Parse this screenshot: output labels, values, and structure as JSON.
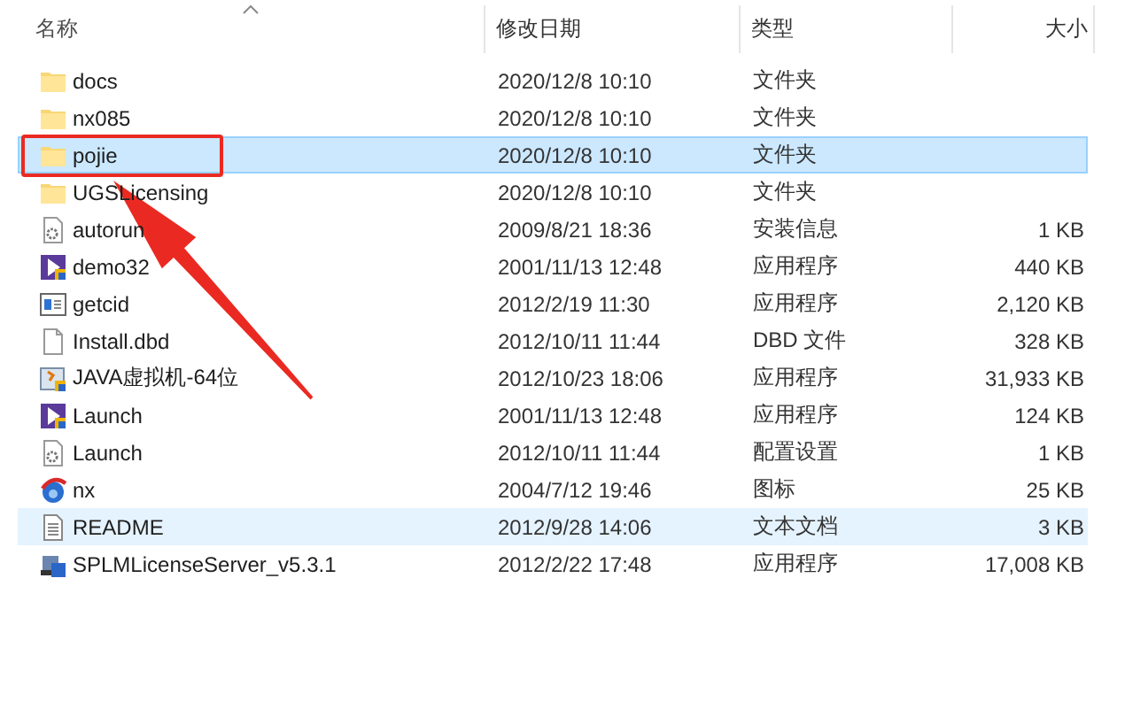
{
  "columns": [
    {
      "label": "名称",
      "sorted": true
    },
    {
      "label": "修改日期",
      "sorted": false
    },
    {
      "label": "类型",
      "sorted": false
    },
    {
      "label": "大小",
      "sorted": false
    }
  ],
  "rows": [
    {
      "name": "docs",
      "date": "2020/12/8 10:10",
      "type": "文件夹",
      "kind": "folder",
      "selected": false,
      "hovered": false,
      "marked": false
    },
    {
      "name": "nx085",
      "date": "2020/12/8 10:10",
      "type": "文件夹",
      "kind": "folder",
      "selected": false,
      "hovered": false,
      "marked": false
    },
    {
      "name": "pojie",
      "date": "2020/12/8 10:10",
      "type": "文件夹",
      "kind": "folder",
      "selected": true,
      "hovered": false,
      "marked": true
    },
    {
      "name": "UGSLicensing",
      "date": "2020/12/8 10:10",
      "type": "文件夹",
      "kind": "folder",
      "selected": false,
      "hovered": false,
      "marked": false
    },
    {
      "name": "autorun",
      "date": "2009/8/21 18:36",
      "type": "安装信息",
      "size": "1 KB",
      "kind": "settings",
      "selected": false,
      "hovered": false,
      "marked": false
    },
    {
      "name": "demo32",
      "date": "2001/11/13 12:48",
      "type": "应用程序",
      "size": "440 KB",
      "kind": "player",
      "selected": false,
      "hovered": false,
      "marked": false
    },
    {
      "name": "getcid",
      "date": "2012/2/19 11:30",
      "type": "应用程序",
      "size": "2,120 KB",
      "kind": "window",
      "selected": false,
      "hovered": false,
      "marked": false
    },
    {
      "name": "Install.dbd",
      "date": "2012/10/11 11:44",
      "type": "DBD 文件",
      "size": "328 KB",
      "kind": "blank",
      "selected": false,
      "hovered": false,
      "marked": false
    },
    {
      "name": "JAVA虚拟机-64位",
      "date": "2012/10/23 18:06",
      "type": "应用程序",
      "size": "31,933 KB",
      "kind": "installer",
      "selected": false,
      "hovered": false,
      "marked": false
    },
    {
      "name": "Launch",
      "date": "2001/11/13 12:48",
      "type": "应用程序",
      "size": "124 KB",
      "kind": "player",
      "selected": false,
      "hovered": false,
      "marked": false
    },
    {
      "name": "Launch",
      "date": "2012/10/11 11:44",
      "type": "配置设置",
      "size": "1 KB",
      "kind": "settings",
      "selected": false,
      "hovered": false,
      "marked": false
    },
    {
      "name": "nx",
      "date": "2004/7/12 19:46",
      "type": "图标",
      "size": "25 KB",
      "kind": "globe",
      "selected": false,
      "hovered": false,
      "marked": false
    },
    {
      "name": "README",
      "date": "2012/9/28 14:06",
      "type": "文本文档",
      "size": "3 KB",
      "kind": "text",
      "selected": false,
      "hovered": true,
      "marked": false
    },
    {
      "name": "SPLMLicenseServer_v5.3.1",
      "date": "2012/2/22 17:48",
      "type": "应用程序",
      "size": "17,008 KB",
      "kind": "server",
      "selected": false,
      "hovered": false,
      "marked": false
    }
  ]
}
